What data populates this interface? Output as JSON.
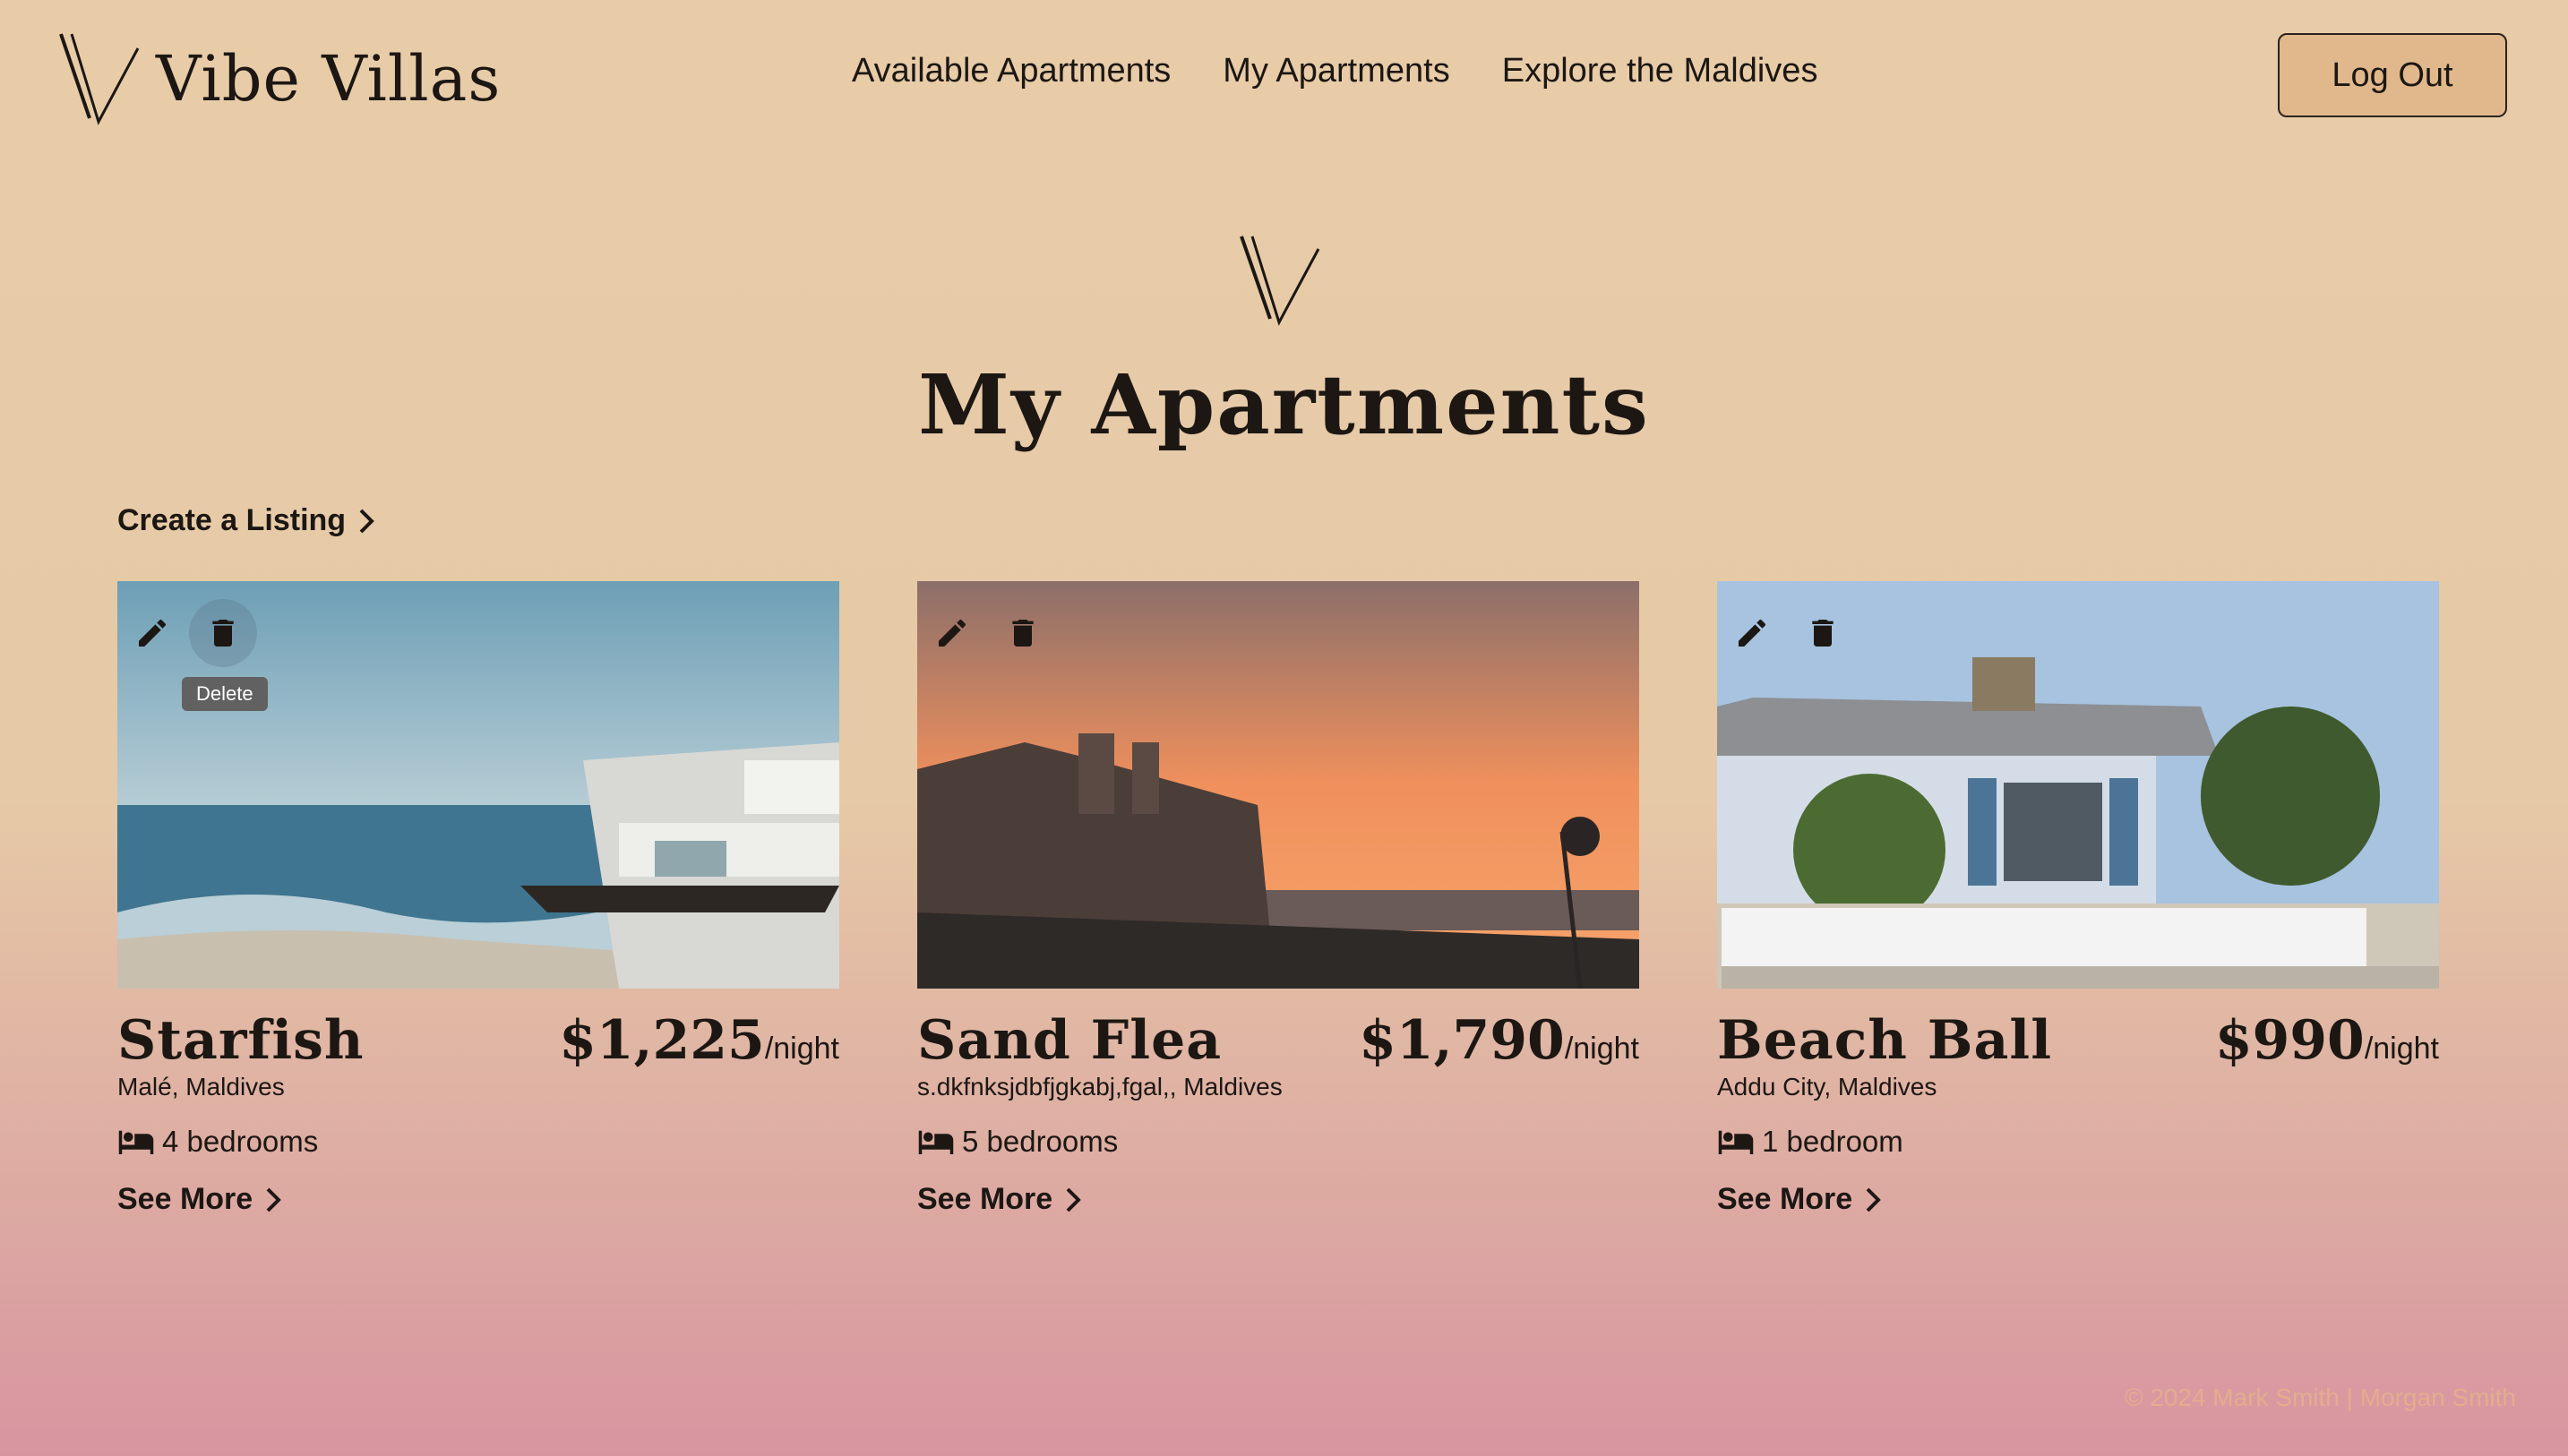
{
  "header": {
    "brand": "Vibe Villas",
    "nav": [
      {
        "label": "Available Apartments"
      },
      {
        "label": "My Apartments"
      },
      {
        "label": "Explore the Maldives"
      }
    ],
    "logout_label": "Log Out"
  },
  "main": {
    "title": "My Apartments",
    "create_label": "Create a Listing",
    "listings": [
      {
        "name": "Starfish",
        "price": "$1,225",
        "per": "/night",
        "location": "Malé, Maldives",
        "bedrooms": "4 bedrooms",
        "see_more": "See More"
      },
      {
        "name": "Sand Flea",
        "price": "$1,790",
        "per": "/night",
        "location": "s.dkfnksjdbfjgkabj,fgal,, Maldives",
        "bedrooms": "5 bedrooms",
        "see_more": "See More"
      },
      {
        "name": "Beach Ball",
        "price": "$990",
        "per": "/night",
        "location": "Addu City, Maldives",
        "bedrooms": "1 bedroom",
        "see_more": "See More"
      }
    ],
    "tooltip": "Delete"
  },
  "footer": {
    "copyright": "© 2024 Mark Smith | Morgan Smith"
  },
  "icons": {
    "edit": "pencil-icon",
    "delete": "trash-icon",
    "beds": "bed-icon",
    "chevron": "chevron-right-icon"
  },
  "colors": {
    "bg_top": "#e8cca8",
    "bg_bottom": "#d795a0",
    "button_bg": "#e0b88b",
    "text": "#1c1713",
    "footer_text": "#e3ad8e"
  }
}
